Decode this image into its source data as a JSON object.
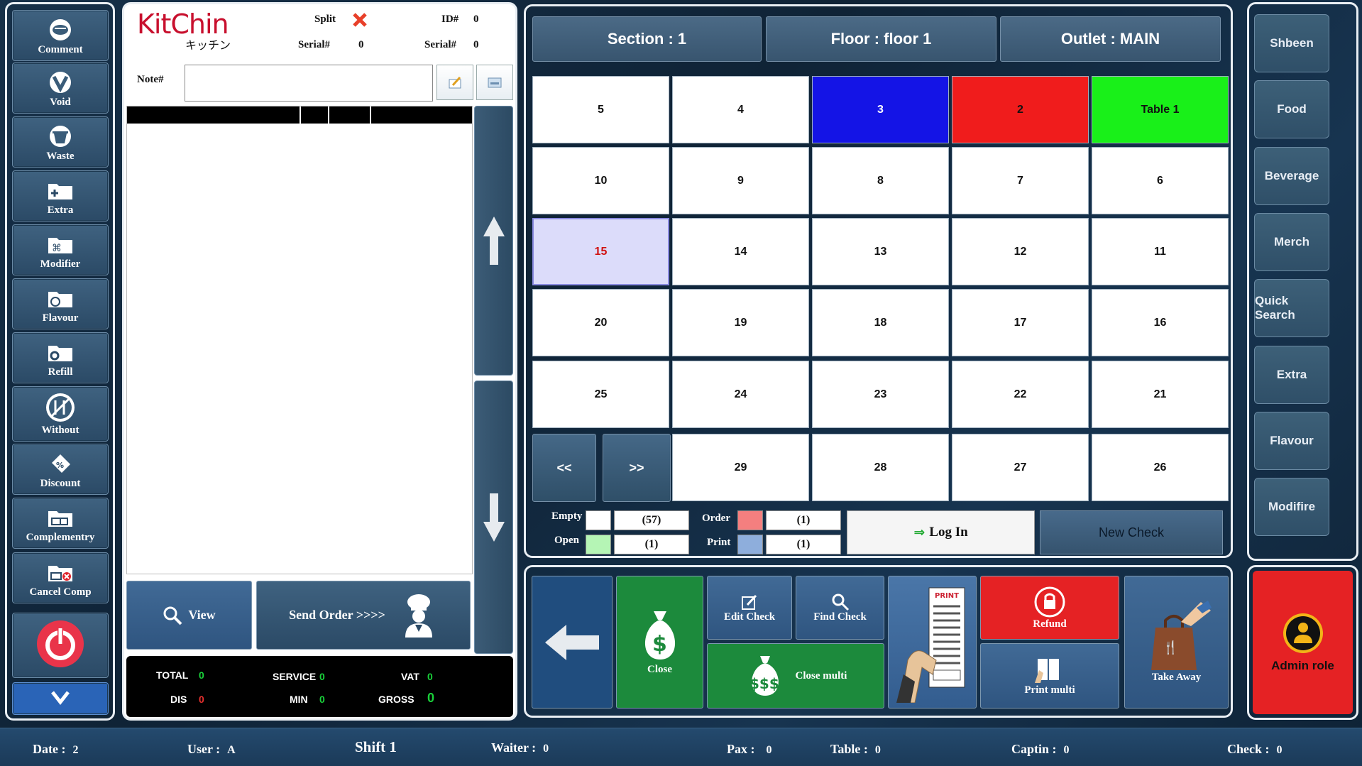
{
  "left_toolbar": {
    "items": [
      {
        "label": "Comment",
        "icon": "comment-icon"
      },
      {
        "label": "Void",
        "icon": "void-icon"
      },
      {
        "label": "Waste",
        "icon": "waste-icon"
      },
      {
        "label": "Extra",
        "icon": "extra-folder-icon"
      },
      {
        "label": "Modifier",
        "icon": "modifier-folder-icon"
      },
      {
        "label": "Flavour",
        "icon": "flavour-folder-icon"
      },
      {
        "label": "Refill",
        "icon": "refill-folder-icon"
      },
      {
        "label": "Without",
        "icon": "without-icon"
      },
      {
        "label": "Discount",
        "icon": "discount-icon"
      },
      {
        "label": "Complementry",
        "icon": "complementry-icon"
      },
      {
        "label": "Cancel Comp",
        "icon": "cancel-comp-icon"
      }
    ],
    "power_icon": "power-icon",
    "down_icon": "chevron-down-icon"
  },
  "order": {
    "logo_text": "KitChin",
    "logo_sub": "キッチン",
    "split_label": "Split",
    "id_label": "ID#",
    "id_value": "0",
    "serial_label": "Serial#",
    "serial_value": "0",
    "serial2_label": "Serial#",
    "serial2_value": "0",
    "note_label": "Note#",
    "note_value": "",
    "view_label": "View",
    "send_label": "Send Order >>>>"
  },
  "summary": {
    "total_label": "TOTAL",
    "total": "0",
    "service_label": "SERVICE",
    "service": "0",
    "vat_label": "VAT",
    "vat": "0",
    "dis_label": "DIS",
    "dis": "0",
    "min_label": "MIN",
    "min": "0",
    "gross_label": "GROSS",
    "gross": "0"
  },
  "header": {
    "section": "Section : 1",
    "floor": "Floor :  floor 1",
    "outlet": "Outlet : MAIN"
  },
  "tables": {
    "rows": [
      [
        "5",
        "4",
        "3",
        "2",
        "Table 1"
      ],
      [
        "10",
        "9",
        "8",
        "7",
        "6"
      ],
      [
        "15",
        "14",
        "13",
        "12",
        "11"
      ],
      [
        "20",
        "19",
        "18",
        "17",
        "16"
      ],
      [
        "25",
        "24",
        "23",
        "22",
        "21"
      ],
      [
        "29",
        "28",
        "27",
        "26"
      ]
    ],
    "prev_label": "<<",
    "next_label": ">>"
  },
  "legend": {
    "empty_label": "Empty",
    "empty_count": "(57)",
    "open_label": "Open",
    "open_count": "(1)",
    "order_label": "Order",
    "order_count": "(1)",
    "print_label": "Print",
    "print_count": "(1)",
    "colors": {
      "empty": "#ffffff",
      "open": "#b5f5b5",
      "order": "#f47f7f",
      "print": "#8eaedc"
    }
  },
  "login_label": "Log In",
  "new_check_label": "New Check",
  "actions": {
    "close": "Close",
    "edit_check": "Edit Check",
    "find_check": "Find Check",
    "close_multi": "Close multi",
    "refund": "Refund",
    "print_multi": "Print multi",
    "take_away": "Take Away",
    "admin": "Admin role",
    "print_tag": "PRINT"
  },
  "categories": [
    "Shbeen",
    "Food",
    "Beverage",
    "Merch",
    "Quick Search",
    "Extra",
    "Flavour",
    "Modifire"
  ],
  "status": {
    "date_label": "Date :",
    "date_value": "2",
    "user_label": "User :",
    "user_value": "A",
    "shift": "Shift 1",
    "waiter_label": "Waiter :",
    "waiter_value": "0",
    "pax_label": "Pax :",
    "pax_value": "0",
    "table_label": "Table :",
    "table_value": "0",
    "captin_label": "Captin :",
    "captin_value": "0",
    "check_label": "Check :",
    "check_value": "0"
  }
}
